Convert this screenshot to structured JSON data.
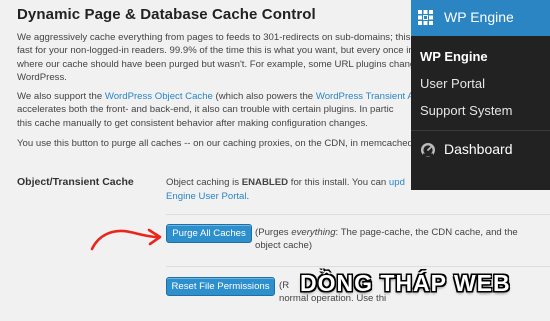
{
  "page": {
    "title": "Dynamic Page & Database Cache Control",
    "para1": [
      "We aggressively cache everything from pages to feeds to 301-redirects on sub-domains; this ma",
      "fast for your non-logged-in readers. 99.9% of the time this is what you want, but every once in a",
      "where our cache should have been purged but wasn't. For example, some URL plugins change b",
      "WordPress."
    ],
    "para2": {
      "line1_a": "We also support the ",
      "line1_link1": "WordPress Object Cache",
      "line1_b": " (which also powers the ",
      "line1_link2": "WordPress Transient API",
      "line1_c": ").",
      "line2": "accelerates both the front- and back-end, it also can trouble with certain plugins. In partic",
      "line3": "this cache manually to get consistent behavior after making configuration changes."
    },
    "para3": "You use this button to purge all caches -- on our caching proxies, on the CDN, in memcached, ev",
    "object_cache": {
      "label": "Object/Transient Cache",
      "text_a": "Object caching is ",
      "text_status": "ENABLED",
      "text_b": " for this install. You can ",
      "link_a": "upd",
      "link_b": "Engine User Portal",
      "text_end": "."
    },
    "purge": {
      "button": "Purge All Caches",
      "desc_a": "(Purges ",
      "desc_em": "everything",
      "desc_b": ": The page-cache, the CDN cache, and the",
      "desc_line2": "object cache)"
    },
    "reset": {
      "button": "Reset File Permissions",
      "desc_a": "(R",
      "desc_line2": "normal operation. Use thi"
    }
  },
  "sidebar": {
    "brand": "WP Engine",
    "items": [
      "WP Engine",
      "User Portal",
      "Support System"
    ],
    "dashboard": "Dashboard"
  },
  "watermark": "DỒNG THÁP WEB",
  "colors": {
    "link": "#2a85c7",
    "button": "#2e8fcd",
    "sidebar_bg": "#222222",
    "brand_bar": "#2b85c2",
    "arrow": "#e8261b"
  },
  "icons": {
    "brand": "wp-engine-grid-icon",
    "dashboard": "dashboard-gauge-icon",
    "arrow": "red-pointer-arrow"
  }
}
